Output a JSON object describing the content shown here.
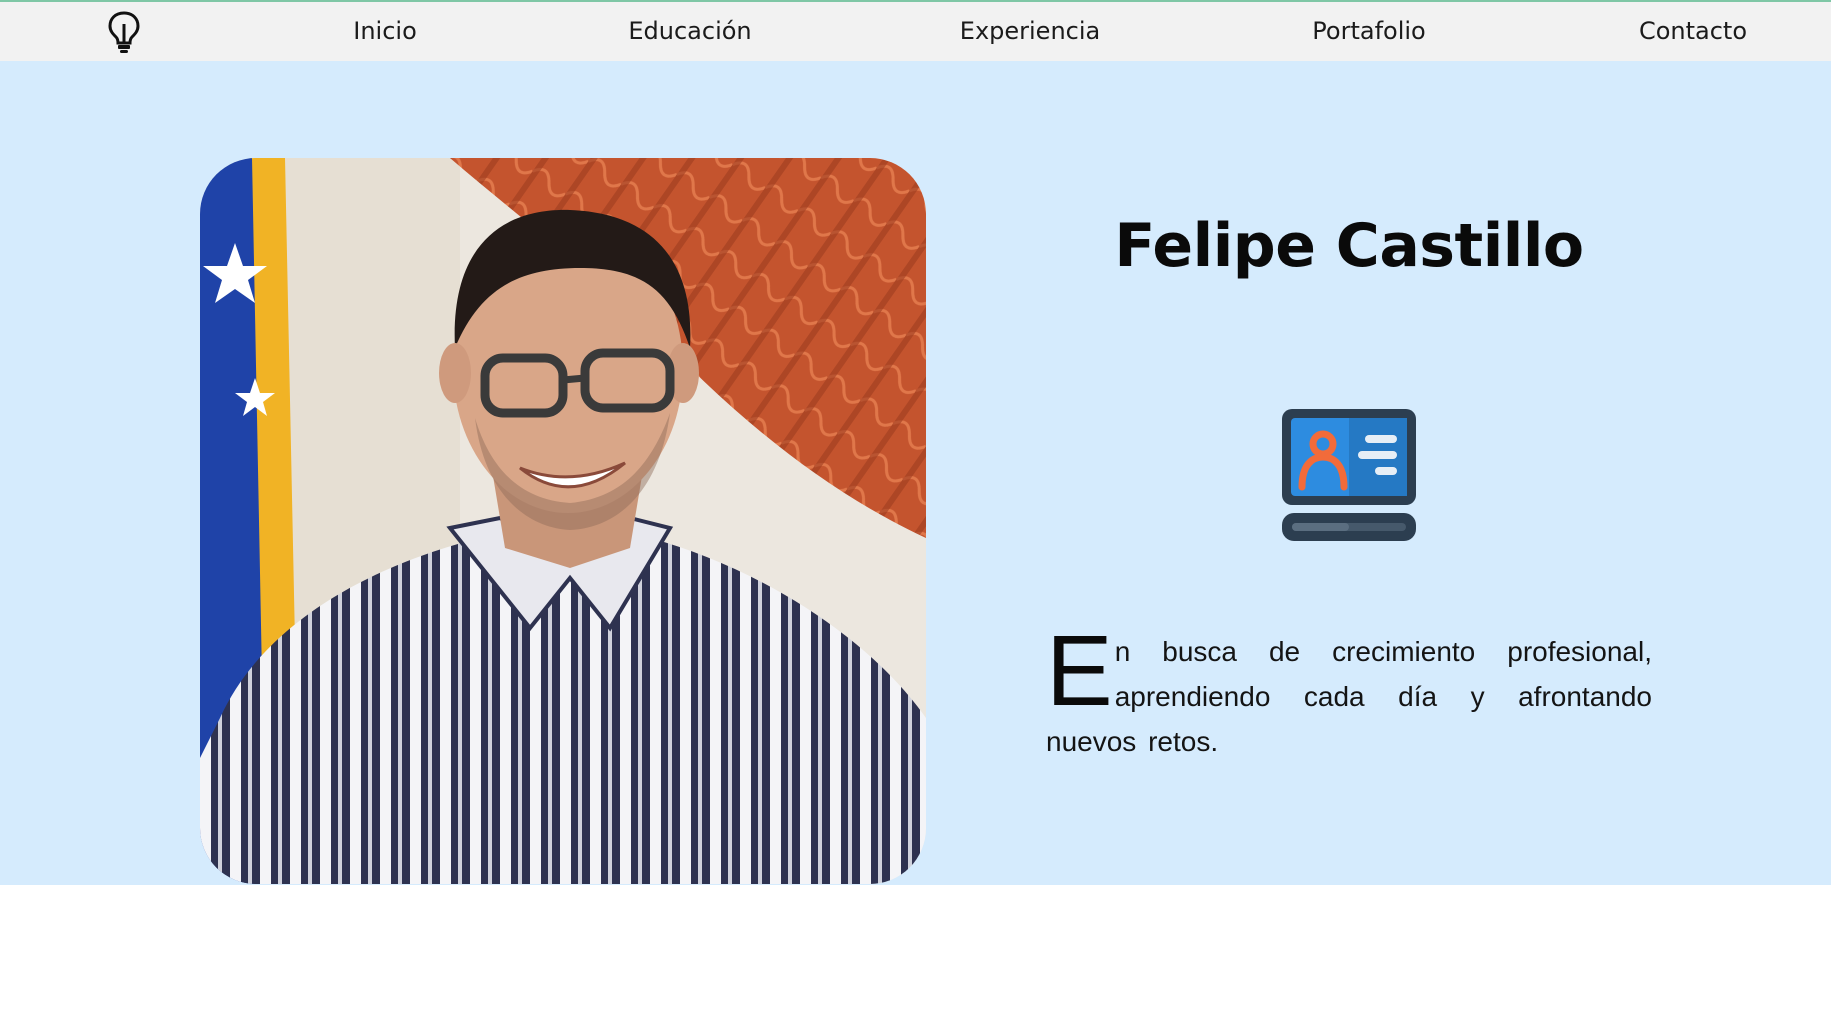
{
  "nav": {
    "logo_icon": "lightbulb-icon",
    "items": [
      {
        "label": "Inicio"
      },
      {
        "label": "Educación"
      },
      {
        "label": "Experiencia"
      },
      {
        "label": "Portafolio"
      },
      {
        "label": "Contacto"
      }
    ]
  },
  "hero": {
    "photo_alt": "Felipe Castillo",
    "name": "Felipe Castillo",
    "icon": "profile-card-icon",
    "tagline_first_letter": "E",
    "tagline_rest": "n busca de crecimiento profesional, aprendiendo cada día y afrontando nuevos retos."
  },
  "colors": {
    "nav_bg": "#f2f2f2",
    "nav_accent": "#7fc7a6",
    "hero_bg": "#d5ebfd",
    "icon_blue": "#2d8ce0",
    "icon_orange": "#f26b3a",
    "icon_dark": "#2c3e50"
  }
}
